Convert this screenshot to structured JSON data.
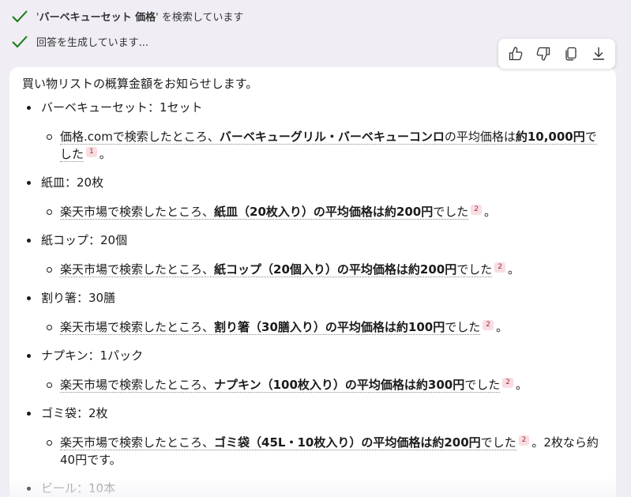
{
  "status": [
    {
      "prefix": "'",
      "bold": "バーベキューセット 価格",
      "suffix": "' を検索しています"
    },
    {
      "prefix": "回答を生成しています...",
      "bold": "",
      "suffix": ""
    }
  ],
  "toolbar": {
    "like_icon": "thumbs-up-icon",
    "dislike_icon": "thumbs-down-icon",
    "copy_icon": "copy-icon",
    "export_icon": "download-icon"
  },
  "message": {
    "intro": "買い物リストの概算金額をお知らせします。",
    "items": [
      {
        "head": "バーベキューセット：1セット",
        "pre": "価格.comで検索したところ、",
        "bold": "バーベキューグリル・バーベキューコンロ",
        "mid": "の平均価格は",
        "bold2": "約10,000円",
        "post": "でした",
        "cite": "1",
        "tail": "。"
      },
      {
        "head": "紙皿：20枚",
        "pre": "楽天市場で検索したところ、",
        "bold": "紙皿（20枚入り）の平均価格は約200円",
        "mid": "",
        "bold2": "",
        "post": "でした",
        "cite": "2",
        "tail": "。"
      },
      {
        "head": "紙コップ：20個",
        "pre": "楽天市場で検索したところ、",
        "bold": "紙コップ（20個入り）の平均価格は約200円",
        "mid": "",
        "bold2": "",
        "post": "でした",
        "cite": "2",
        "tail": "。"
      },
      {
        "head": "割り箸：30膳",
        "pre": "楽天市場で検索したところ、",
        "bold": "割り箸（30膳入り）の平均価格は約100円",
        "mid": "",
        "bold2": "",
        "post": "でした",
        "cite": "2",
        "tail": "。"
      },
      {
        "head": "ナプキン：1パック",
        "pre": "楽天市場で検索したところ、",
        "bold": "ナプキン（100枚入り）の平均価格は約300円",
        "mid": "",
        "bold2": "",
        "post": "でした",
        "cite": "2",
        "tail": "。"
      },
      {
        "head": "ゴミ袋：2枚",
        "pre": "楽天市場で検索したところ、",
        "bold": "ゴミ袋（45L・10枚入り）の平均価格は約200円",
        "mid": "",
        "bold2": "",
        "post": "でした",
        "cite": "2",
        "tail": "。2枚なら約40円です。"
      },
      {
        "head": "ビール：10本",
        "pre": "",
        "bold": "",
        "mid": "",
        "bold2": "",
        "post": "",
        "cite": "",
        "tail": ""
      }
    ]
  },
  "colors": {
    "check": "#107c10",
    "citation_bg": "#f8dde2",
    "page_bg": "#f0eef4"
  }
}
